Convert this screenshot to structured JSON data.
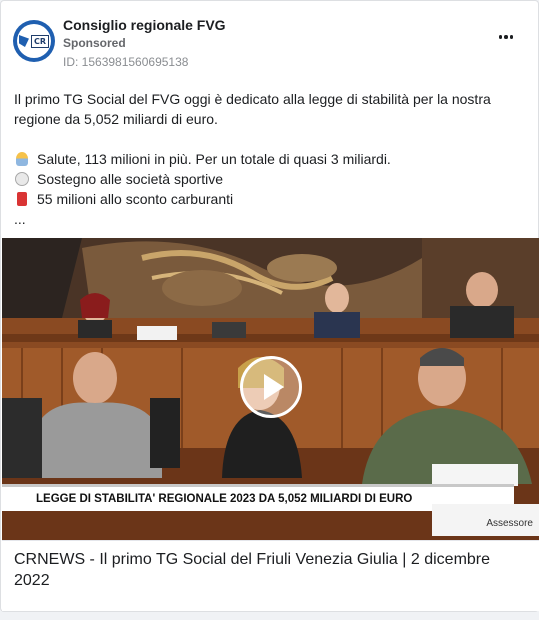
{
  "post": {
    "page_name": "Consiglio regionale FVG",
    "sponsored_label": "Sponsored",
    "ad_id": "ID: 1563981560695138",
    "avatar_text": "CR",
    "more_icon": "more-horizontal-icon"
  },
  "body": {
    "intro": "Il primo TG Social del FVG oggi è dedicato alla legge di stabilità per la nostra regione da 5,052 miliardi di euro.",
    "bullets": [
      {
        "icon": "health-worker-icon",
        "text": "Salute, 113 milioni in più. Per un totale di quasi 3 miliardi."
      },
      {
        "icon": "volleyball-icon",
        "text": "Sostegno alle società sportive"
      },
      {
        "icon": "fuel-pump-icon",
        "text": "55 milioni allo sconto carburanti"
      }
    ],
    "ellipsis": "..."
  },
  "video": {
    "ticker_text": "LEGGE DI STABILITA' REGIONALE 2023 DA 5,052 MILIARDI DI EURO",
    "nameplate_text": "Assessore",
    "play_icon": "play-icon"
  },
  "link": {
    "headline": "CRNEWS - Il primo TG Social del Friuli Venezia Giulia | 2 dicembre 2022"
  },
  "colors": {
    "brand": "#1f5fb0",
    "text": "#1c1e21",
    "secondary": "#65676b"
  }
}
